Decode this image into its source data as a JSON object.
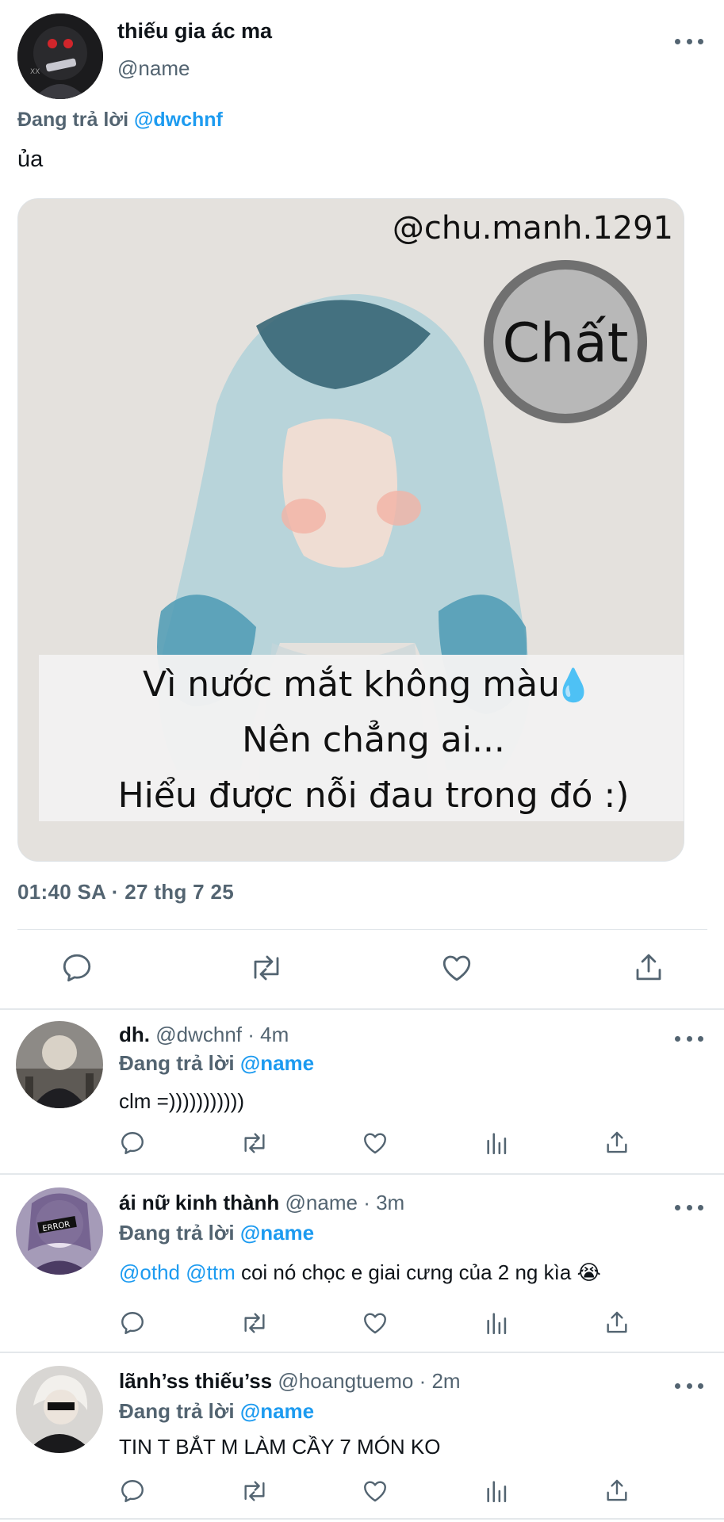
{
  "main_tweet": {
    "display_name": "thiếu gia ác ma",
    "handle": "@name",
    "replying_prefix": "Đang trả lời",
    "replying_to": "@dwchnf",
    "text": "ủa",
    "image": {
      "watermark": "@chu.manh.1291",
      "badge": "Chất",
      "caption_lines": [
        "Vì nước mắt không màu",
        "Nên chẳng ai...",
        "Hiểu được nỗi đau trong đó :)"
      ],
      "caption_emoji": "💧"
    },
    "timestamp": "01:40 SA · 27 thg 7 25"
  },
  "replies": [
    {
      "display_name": "dh.",
      "handle": "@dwchnf",
      "time": "· 4m",
      "replying_prefix": "Đang trả lời",
      "replying_to": "@name",
      "text": "clm =)))))))))))",
      "mentions": []
    },
    {
      "display_name": "ái nữ kinh thành",
      "handle": "@name",
      "time": "· 3m",
      "replying_prefix": "Đang trả lời",
      "replying_to": "@name",
      "text": "coi nó chọc e giai cưng của 2 ng kìa 😭",
      "mentions": [
        "@othd",
        "@ttm"
      ]
    },
    {
      "display_name": "lãnh’ss thiếu’ss",
      "handle": "@hoangtuemo",
      "time": "· 2m",
      "replying_prefix": "Đang trả lời",
      "replying_to": "@name",
      "text": "TIN T BẮT M LÀM CẦY 7 MÓN KO",
      "mentions": []
    }
  ],
  "icons": {
    "reply": "reply-icon",
    "retweet": "retweet-icon",
    "like": "heart-icon",
    "views": "views-icon",
    "share": "share-icon",
    "more": "more-icon"
  },
  "colors": {
    "text": "#0f1419",
    "secondary": "#536471",
    "mention": "#1d9bf0",
    "divider": "#e1e6ea"
  }
}
